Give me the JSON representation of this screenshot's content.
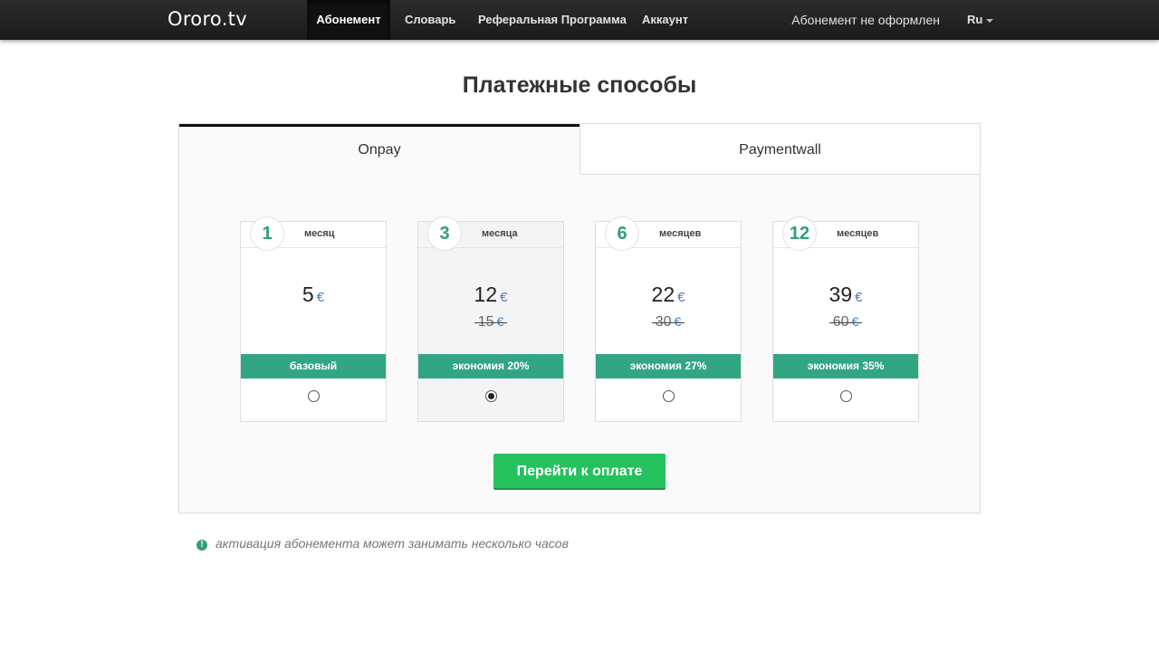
{
  "navbar": {
    "brand": "Ororo.tv",
    "items": [
      {
        "label": "Абонемент"
      },
      {
        "label": "Словарь"
      },
      {
        "label": "Реферальная Программа"
      },
      {
        "label": "Аккаунт"
      }
    ],
    "status": "Абонемент не оформлен",
    "language": "Ru"
  },
  "page": {
    "title": "Платежные способы"
  },
  "tabs": [
    {
      "label": "Onpay",
      "active": true
    },
    {
      "label": "Paymentwall",
      "active": false
    }
  ],
  "plans": [
    {
      "count": "1",
      "unit": "месяц",
      "price": "5",
      "old_price": "",
      "currency": "€",
      "badge": "базовый",
      "selected": false
    },
    {
      "count": "3",
      "unit": "месяца",
      "price": "12",
      "old_price": "15",
      "currency": "€",
      "badge": "экономия 20%",
      "selected": true
    },
    {
      "count": "6",
      "unit": "месяцев",
      "price": "22",
      "old_price": "30",
      "currency": "€",
      "badge": "экономия 27%",
      "selected": false
    },
    {
      "count": "12",
      "unit": "месяцев",
      "price": "39",
      "old_price": "60",
      "currency": "€",
      "badge": "экономия 35%",
      "selected": false
    }
  ],
  "pay_button": "Перейти к оплате",
  "note": {
    "icon": "exclamation-circle-icon",
    "text": "активация абонемента может занимать несколько часов"
  },
  "colors": {
    "accent_green": "#32a683",
    "button_green": "#25c15f",
    "currency_blue": "#3d7ec4",
    "navbar": "#222222"
  }
}
